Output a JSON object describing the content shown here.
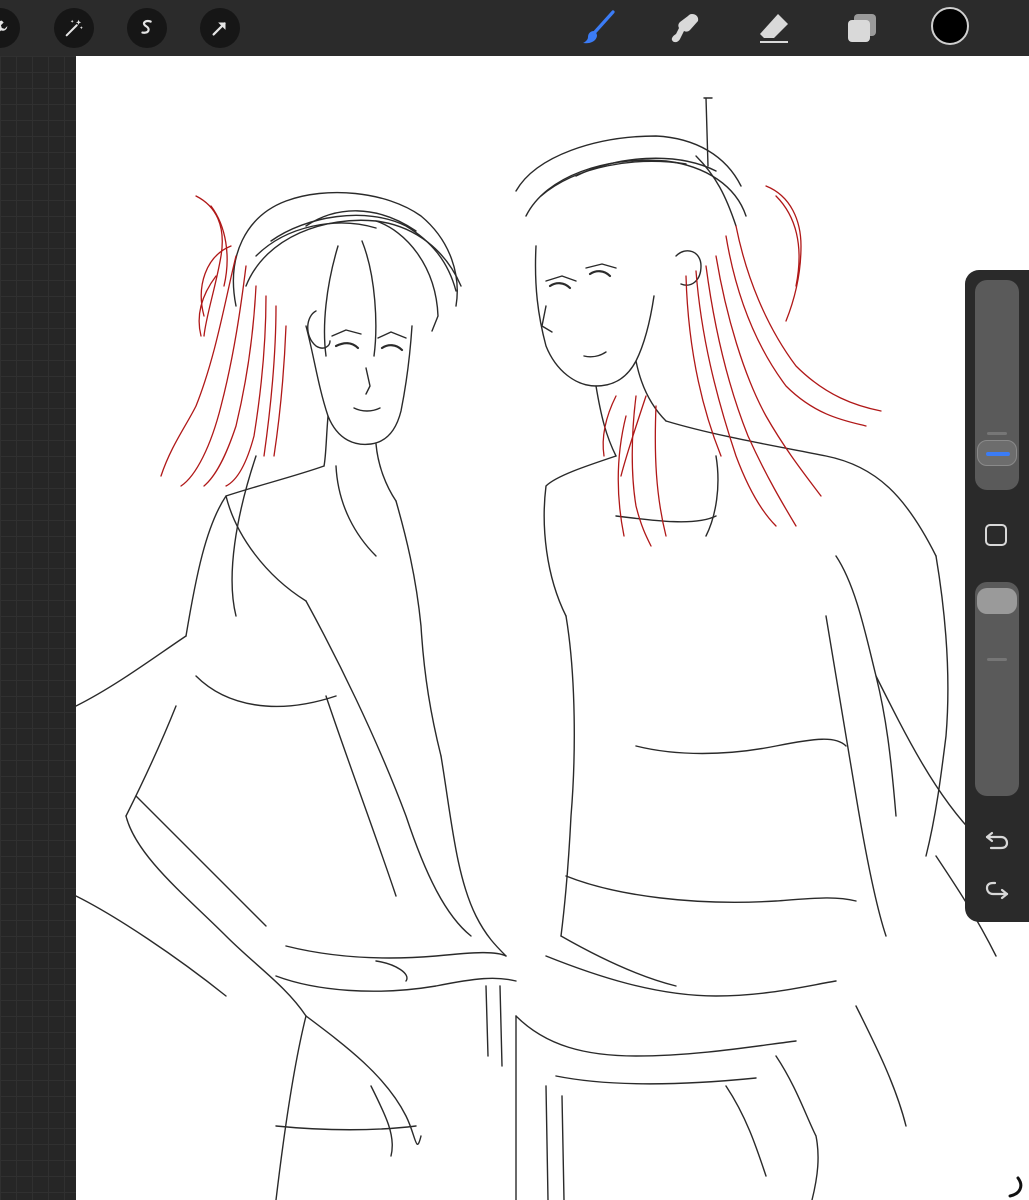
{
  "toolbar": {
    "left_tools": [
      {
        "icon": "wrench-icon"
      },
      {
        "icon": "magic-wand-icon"
      },
      {
        "icon": "selection-icon"
      },
      {
        "icon": "transform-arrow-icon"
      }
    ],
    "right_tools": [
      {
        "icon": "brush-icon",
        "active": true
      },
      {
        "icon": "smudge-icon"
      },
      {
        "icon": "eraser-icon"
      },
      {
        "icon": "layers-icon"
      }
    ],
    "current_color": "#000000",
    "active_color": "#3b7cf6"
  },
  "sidebar": {
    "brush_size": 0.25,
    "opacity": 1.0,
    "icons": [
      "modifier-square-icon",
      "undo-icon",
      "redo-icon"
    ]
  },
  "colors": {
    "canvas_background": "#ffffff",
    "line_art": "#2a2a2a",
    "hair_accent": "#b01818"
  }
}
